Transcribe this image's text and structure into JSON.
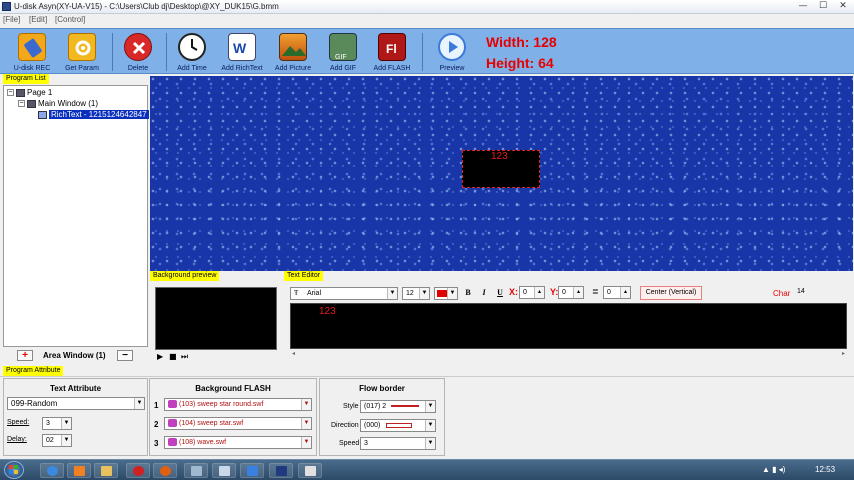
{
  "window": {
    "title": "U-disk Asyn(XY-UA-V15) - C:\\Users\\Club dj\\Desktop\\@XY_DUK15\\G.bmm",
    "minimize": "—",
    "maximize": "☐",
    "close": "✕"
  },
  "menu": [
    "[File]",
    "[Edit]",
    "[Control]"
  ],
  "toolbar": {
    "buttons": [
      {
        "label": "U-disk REC",
        "icon": "usb-icon"
      },
      {
        "label": "Get Param",
        "icon": "gear-icon"
      },
      {
        "label": "Delete",
        "icon": "delete-icon"
      },
      {
        "label": "Add Time",
        "icon": "clock-icon"
      },
      {
        "label": "Add RichText",
        "icon": "word-doc-icon"
      },
      {
        "label": "Add Picture",
        "icon": "picture-icon"
      },
      {
        "label": "Add GIF",
        "icon": "gif-icon"
      },
      {
        "label": "Add FLASH",
        "icon": "flash-icon"
      },
      {
        "label": "Preview",
        "icon": "play-icon"
      }
    ],
    "width_text": "Width:  128",
    "height_text": "Height: 64"
  },
  "colors": {
    "toolbar_bg": "#7fb0e8",
    "canvas_bg": "#1836a8",
    "accent_red": "#e80000",
    "tab_yellow": "#ffff00",
    "selection_blue": "#0a2fbf"
  },
  "program_list": {
    "tab_label": "Program List",
    "tree": [
      {
        "label": "Page 1",
        "level": 0
      },
      {
        "label": "Main Window  (1)",
        "level": 1
      },
      {
        "label": "RichText - 1215124642847",
        "level": 2,
        "selected": true
      }
    ],
    "area_label": "Area Window (1)",
    "add_button": "+",
    "remove_button": "−"
  },
  "canvas": {
    "richtext_content": "123"
  },
  "background_preview": {
    "tab_label": "Background preview",
    "play": "▶",
    "stop": "■",
    "next": "⏭"
  },
  "text_editor": {
    "tab_label": "Text Editor",
    "font": "Arial",
    "font_size": "12",
    "bold": "B",
    "italic": "I",
    "underline": "U",
    "x_label": "X:",
    "x_value": "0",
    "y_label": "Y:",
    "y_value": "0",
    "line_value": "0",
    "align": "Center (Vertical)",
    "char_label": "Char",
    "char_value": "14",
    "content": "123"
  },
  "program_attribute": {
    "tab_label": "Program Attribute",
    "text_attribute": {
      "title": "Text Attribute",
      "effect": "099-Random",
      "speed_label": "Speed:",
      "speed": "3",
      "delay_label": "Delay:",
      "delay": "02"
    },
    "background_flash": {
      "title": "Background FLASH",
      "items": [
        {
          "num": "1",
          "value": "(103) sweep star round.swf"
        },
        {
          "num": "2",
          "value": "(104) sweep star.swf"
        },
        {
          "num": "3",
          "value": "(108) wave.swf"
        }
      ]
    },
    "flow_border": {
      "title": "Flow border",
      "style_label": "Style",
      "style": "(017) 2",
      "direction_label": "Direction",
      "direction": "(000)",
      "speed_label": "Speed",
      "speed": "3"
    }
  },
  "taskbar": {
    "clock": "12:53"
  }
}
